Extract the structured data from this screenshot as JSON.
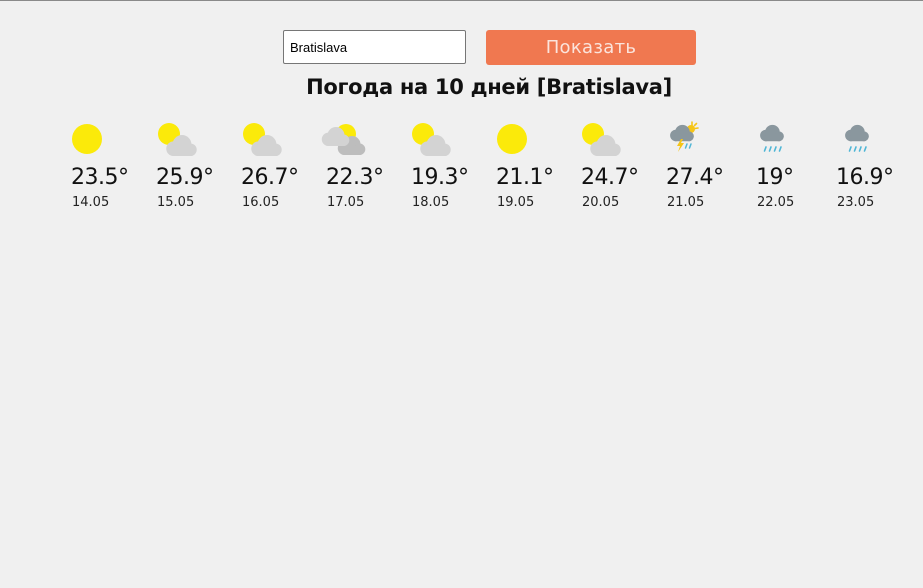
{
  "search": {
    "value": "Bratislava",
    "button_label": "Показать",
    "button_color": "#f07850"
  },
  "title": "Погода на 10 дней [Bratislava]",
  "days": [
    {
      "temp": "23.5°",
      "date": "14.05",
      "icon": "sun-icon"
    },
    {
      "temp": "25.9°",
      "date": "15.05",
      "icon": "partly-cloudy-icon"
    },
    {
      "temp": "26.7°",
      "date": "16.05",
      "icon": "partly-cloudy-icon"
    },
    {
      "temp": "22.3°",
      "date": "17.05",
      "icon": "cloudy-icon"
    },
    {
      "temp": "19.3°",
      "date": "18.05",
      "icon": "partly-cloudy-icon"
    },
    {
      "temp": "21.1°",
      "date": "19.05",
      "icon": "sun-icon"
    },
    {
      "temp": "24.7°",
      "date": "20.05",
      "icon": "partly-cloudy-icon"
    },
    {
      "temp": "27.4°",
      "date": "21.05",
      "icon": "thunderstorm-icon"
    },
    {
      "temp": "19°",
      "date": "22.05",
      "icon": "rain-icon"
    },
    {
      "temp": "16.9°",
      "date": "23.05",
      "icon": "rain-icon"
    }
  ],
  "colors": {
    "sun": "#fbea0a",
    "cloud": "#d3d3d3",
    "cloud_dark": "#bdbdbd",
    "rain_cloud": "#8a979e",
    "rain_drop": "#4fb6d6"
  }
}
